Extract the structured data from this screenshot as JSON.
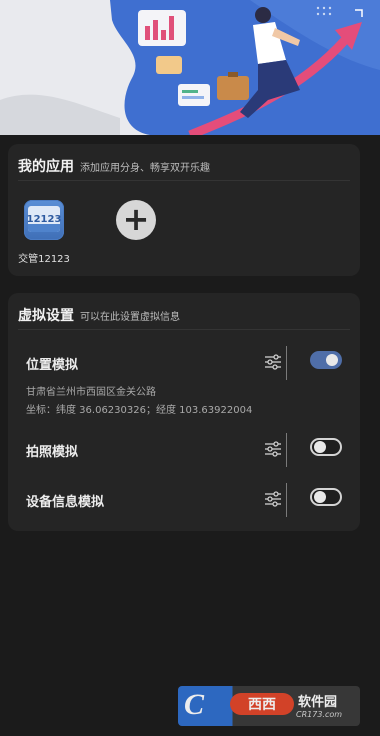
{
  "banner": {
    "illustration": "running-businessman-with-briefcase-and-growth-chart"
  },
  "my_apps": {
    "title": "我的应用",
    "subtitle": "添加应用分身、畅享双开乐趣",
    "apps": [
      {
        "label": "交管12123",
        "icon_text": "12123",
        "icon": "jiaoguan-12123-app-icon"
      }
    ],
    "add_icon": "plus-icon"
  },
  "virtual_settings": {
    "title": "虚拟设置",
    "subtitle": "可以在此设置虚拟信息",
    "location": {
      "label": "位置模拟",
      "address": "甘肃省兰州市西固区金关公路",
      "coords": "坐标：纬度 36.06230326；经度 103.63922004",
      "enabled": true
    },
    "photo": {
      "label": "拍照模拟",
      "enabled": false
    },
    "device": {
      "label": "设备信息模拟",
      "enabled": false
    },
    "settings_icon": "sliders-icon"
  },
  "watermark": {
    "brand_letter": "C",
    "brand_red": "西西",
    "name": "软件园",
    "url": "CR173.com"
  },
  "colors": {
    "background": "#1b1b1b",
    "card": "#252525",
    "toggle_on": "#4f6ea8",
    "banner_blue": "#3f6fd0"
  }
}
